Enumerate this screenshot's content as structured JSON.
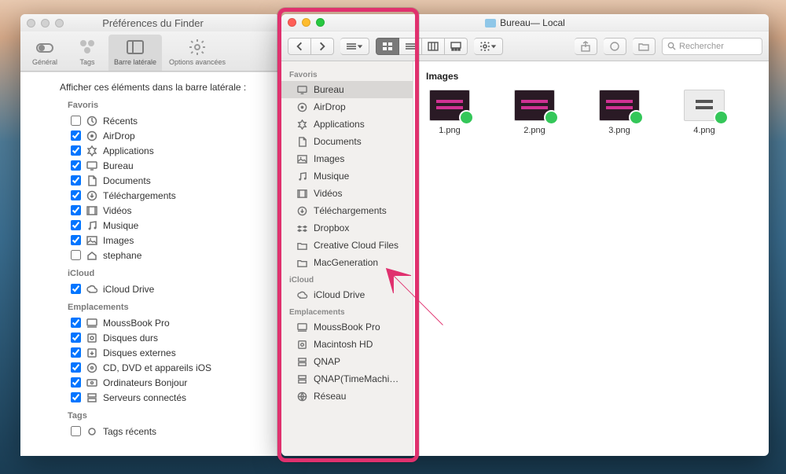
{
  "prefs": {
    "window_title": "Préférences du Finder",
    "tabs": {
      "general": "Général",
      "tags": "Tags",
      "sidebar": "Barre latérale",
      "advanced": "Options avancées"
    },
    "caption": "Afficher ces éléments dans la barre latérale :",
    "sections": {
      "favoris": {
        "title": "Favoris",
        "items": [
          {
            "label": "Récents",
            "checked": false,
            "icon": "clock-icon"
          },
          {
            "label": "AirDrop",
            "checked": true,
            "icon": "airdrop-icon"
          },
          {
            "label": "Applications",
            "checked": true,
            "icon": "applications-icon"
          },
          {
            "label": "Bureau",
            "checked": true,
            "icon": "desktop-icon"
          },
          {
            "label": "Documents",
            "checked": true,
            "icon": "documents-icon"
          },
          {
            "label": "Téléchargements",
            "checked": true,
            "icon": "downloads-icon"
          },
          {
            "label": "Vidéos",
            "checked": true,
            "icon": "movies-icon"
          },
          {
            "label": "Musique",
            "checked": true,
            "icon": "music-icon"
          },
          {
            "label": "Images",
            "checked": true,
            "icon": "pictures-icon"
          },
          {
            "label": "stephane",
            "checked": false,
            "icon": "home-icon"
          }
        ]
      },
      "icloud": {
        "title": "iCloud",
        "items": [
          {
            "label": "iCloud Drive",
            "checked": true,
            "icon": "cloud-icon"
          }
        ]
      },
      "emplacements": {
        "title": "Emplacements",
        "items": [
          {
            "label": "MoussBook Pro",
            "checked": true,
            "icon": "computer-icon"
          },
          {
            "label": "Disques durs",
            "checked": true,
            "icon": "disk-icon"
          },
          {
            "label": "Disques externes",
            "checked": true,
            "icon": "external-disk-icon"
          },
          {
            "label": "CD, DVD et appareils iOS",
            "checked": true,
            "icon": "disc-icon"
          },
          {
            "label": "Ordinateurs Bonjour",
            "checked": true,
            "icon": "bonjour-icon"
          },
          {
            "label": "Serveurs connectés",
            "checked": true,
            "icon": "server-icon"
          }
        ]
      },
      "tags": {
        "title": "Tags",
        "items": [
          {
            "label": "Tags récents",
            "checked": false,
            "icon": "tag-icon"
          }
        ]
      }
    }
  },
  "finder": {
    "title_prefix": "Bureau",
    "title_suffix": " — Local",
    "search_placeholder": "Rechercher",
    "path_title": "Images",
    "sidebar": {
      "favoris": {
        "title": "Favoris",
        "items": [
          {
            "label": "Bureau",
            "icon": "desktop-icon",
            "active": true
          },
          {
            "label": "AirDrop",
            "icon": "airdrop-icon"
          },
          {
            "label": "Applications",
            "icon": "applications-icon"
          },
          {
            "label": "Documents",
            "icon": "documents-icon"
          },
          {
            "label": "Images",
            "icon": "pictures-icon"
          },
          {
            "label": "Musique",
            "icon": "music-icon"
          },
          {
            "label": "Vidéos",
            "icon": "movies-icon"
          },
          {
            "label": "Téléchargements",
            "icon": "downloads-icon"
          },
          {
            "label": "Dropbox",
            "icon": "dropbox-icon"
          },
          {
            "label": "Creative Cloud Files",
            "icon": "folder-icon"
          },
          {
            "label": "MacGeneration",
            "icon": "folder-icon"
          }
        ]
      },
      "icloud": {
        "title": "iCloud",
        "items": [
          {
            "label": "iCloud Drive",
            "icon": "cloud-icon"
          }
        ]
      },
      "emplacements": {
        "title": "Emplacements",
        "items": [
          {
            "label": "MoussBook Pro",
            "icon": "computer-icon"
          },
          {
            "label": "Macintosh HD",
            "icon": "disk-icon"
          },
          {
            "label": "QNAP",
            "icon": "server-icon"
          },
          {
            "label": "QNAP(TimeMachi…",
            "icon": "server-icon"
          },
          {
            "label": "Réseau",
            "icon": "network-icon"
          }
        ]
      }
    },
    "files": [
      {
        "name": "1.png"
      },
      {
        "name": "2.png"
      },
      {
        "name": "3.png"
      },
      {
        "name": "4.png"
      }
    ]
  },
  "colors": {
    "highlight": "#e0316e",
    "sync_badge": "#34c759"
  }
}
